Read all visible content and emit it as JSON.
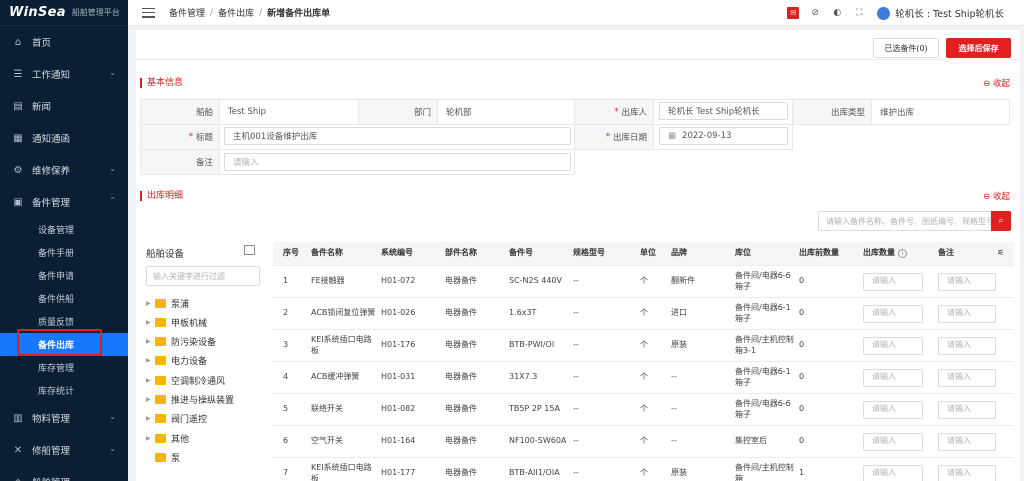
{
  "brand": {
    "name": "WinSea",
    "subtitle": "船舶管理平台"
  },
  "sidebar": {
    "items": [
      {
        "label": "首页",
        "icon": "home-icon",
        "glyph": "⌂"
      },
      {
        "label": "工作通知",
        "icon": "notice-icon",
        "glyph": "☰"
      },
      {
        "label": "新闻",
        "icon": "news-icon",
        "glyph": "▤"
      },
      {
        "label": "通知通函",
        "icon": "bulletin-icon",
        "glyph": "▦"
      },
      {
        "label": "维修保养",
        "icon": "maintenance-icon",
        "glyph": "⚙"
      },
      {
        "label": "备件管理",
        "icon": "spare-parts-icon",
        "glyph": "▣"
      }
    ],
    "sub_items": [
      "设备管理",
      "备件手册",
      "备件申请",
      "备件供船",
      "质量反馈",
      "备件出库",
      "库存管理",
      "库存统计"
    ],
    "active_sub": "备件出库",
    "bottom_items": [
      {
        "label": "物料管理",
        "icon": "materials-icon",
        "glyph": "▥"
      },
      {
        "label": "修船管理",
        "icon": "repair-icon",
        "glyph": "✕"
      },
      {
        "label": "船舶管理",
        "icon": "ship-icon",
        "glyph": "◈"
      }
    ]
  },
  "header": {
    "breadcrumb": [
      "备件管理",
      "备件出库",
      "新增备件出库单"
    ],
    "user": "轮机长 : Test Ship轮机长"
  },
  "toolbar": {
    "selected_label": "已选备件(0)",
    "save_label": "选择后保存"
  },
  "basic_info": {
    "section_title": "基本信息",
    "collapse_label": "收起",
    "ship_label": "船舶",
    "ship_value": "Test Ship",
    "dept_label": "部门",
    "dept_value": "轮机部",
    "issuer_label": "出库人",
    "issuer_value": "轮机长  Test Ship轮机长",
    "type_label": "出库类型",
    "type_value": "维护出库",
    "title_label": "标题",
    "title_value": "主机001设备维护出库",
    "date_label": "出库日期",
    "date_value": "2022-09-13",
    "remark_label": "备注",
    "remark_placeholder": "请输入"
  },
  "detail": {
    "section_title": "出库明细",
    "collapse_label": "收起",
    "search_placeholder": "请输入备件名称、备件号、图纸编号、规格型号",
    "tree_title": "船舶设备",
    "tree_search_placeholder": "输入关键字进行过滤",
    "tree_nodes": [
      "泵浦",
      "甲板机械",
      "防污染设备",
      "电力设备",
      "空调制冷通风",
      "推进与操纵装置",
      "阀门遥控",
      "其他",
      "泵"
    ],
    "columns": [
      "序号",
      "备件名称",
      "系统编号",
      "部件名称",
      "备件号",
      "规格型号",
      "单位",
      "品牌",
      "库位",
      "出库前数量",
      "出库数量",
      "备注"
    ],
    "qty_placeholder": "请输入",
    "rows": [
      {
        "no": "1",
        "name": "FE接触器",
        "sys": "H01-072",
        "part": "电器备件",
        "code": "SC-N2S 440V",
        "spec": "--",
        "unit": "个",
        "brand": "翻新件",
        "loc": "备件间/电器6-6箱子",
        "before": "0"
      },
      {
        "no": "2",
        "name": "ACB锁闭复位弹簧",
        "sys": "H01-026",
        "part": "电器备件",
        "code": "1.6x3T",
        "spec": "--",
        "unit": "个",
        "brand": "进口",
        "loc": "备件间/电器6-1箱子",
        "before": "0"
      },
      {
        "no": "3",
        "name": "KEI系统插口电路板",
        "sys": "H01-176",
        "part": "电器备件",
        "code": "BTB-PWI/OI",
        "spec": "--",
        "unit": "个",
        "brand": "原装",
        "loc": "备件间/主机控制箱3-1",
        "before": "0"
      },
      {
        "no": "4",
        "name": "ACB缓冲弹簧",
        "sys": "H01-031",
        "part": "电器备件",
        "code": "31X7.3",
        "spec": "--",
        "unit": "个",
        "brand": "--",
        "loc": "备件间/电器6-1箱子",
        "before": "0"
      },
      {
        "no": "5",
        "name": "联络开关",
        "sys": "H01-082",
        "part": "电器备件",
        "code": "TB5P 2P 15A",
        "spec": "--",
        "unit": "个",
        "brand": "--",
        "loc": "备件间/电器6-6箱子",
        "before": "0"
      },
      {
        "no": "6",
        "name": "空气开关",
        "sys": "H01-164",
        "part": "电器备件",
        "code": "NF100-SW60A",
        "spec": "--",
        "unit": "个",
        "brand": "--",
        "loc": "集控室后",
        "before": "0"
      },
      {
        "no": "7",
        "name": "KEI系统插口电路板",
        "sys": "H01-177",
        "part": "电器备件",
        "code": "BTB-AII1/OIA",
        "spec": "--",
        "unit": "个",
        "brand": "原装",
        "loc": "备件间/主机控制箱",
        "before": "1"
      }
    ]
  }
}
